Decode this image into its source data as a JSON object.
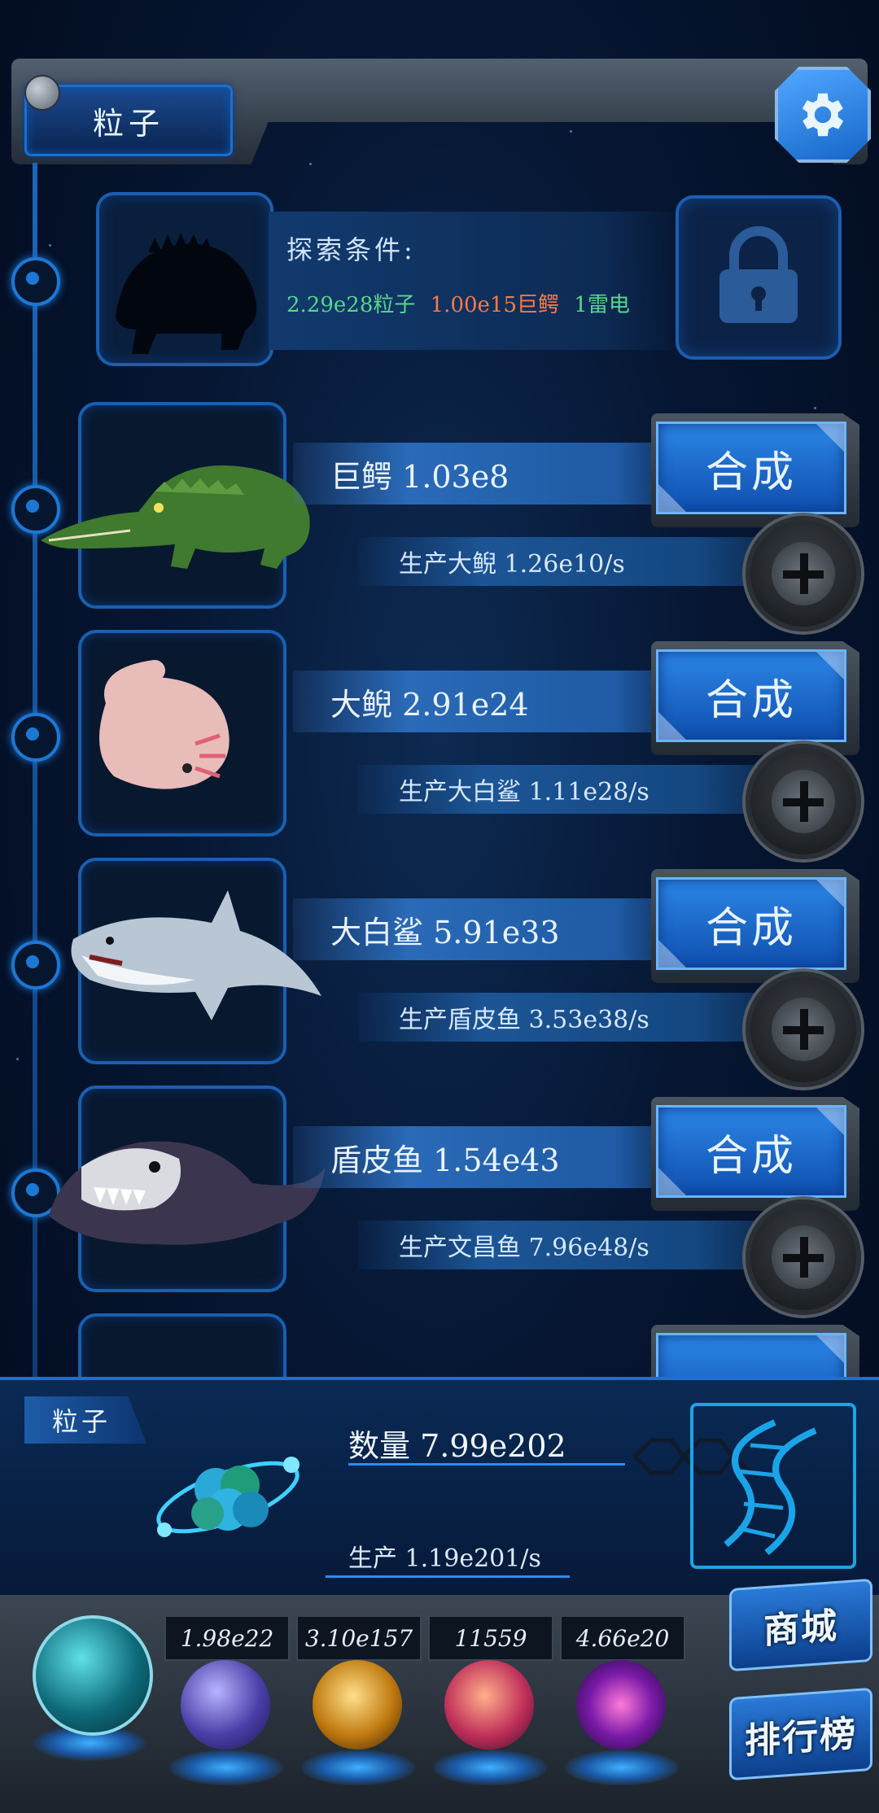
{
  "top_bar": {
    "category_tab": "粒子"
  },
  "locked": {
    "title": "探索条件:",
    "requirements": [
      {
        "text": "2.29e28粒子",
        "color": "#58d68d"
      },
      {
        "text": "1.00e15巨鳄",
        "color": "#ff7a45"
      },
      {
        "text": "1雷电",
        "color": "#58d68d"
      }
    ]
  },
  "creatures": [
    {
      "name": "巨鳄 1.03e8",
      "production": "生产大鲵 1.26e10/s",
      "synth_label": "合成",
      "art": "crocodile"
    },
    {
      "name": "大鲵 2.91e24",
      "production": "生产大白鲨 1.11e28/s",
      "synth_label": "合成",
      "art": "axolotl"
    },
    {
      "name": "大白鲨 5.91e33",
      "production": "生产盾皮鱼 3.53e38/s",
      "synth_label": "合成",
      "art": "shark"
    },
    {
      "name": "盾皮鱼 1.54e43",
      "production": "生产文昌鱼 7.96e48/s",
      "synth_label": "合成",
      "art": "dunkleosteus"
    }
  ],
  "resource": {
    "tab": "粒子",
    "amount": "数量 7.99e202",
    "rate": "生产 1.19e201/s"
  },
  "bottom_bar": {
    "values": [
      "1.98e22",
      "3.10e157",
      "11559",
      "4.66e20"
    ],
    "shop_label": "商城",
    "rank_label": "排行榜",
    "orbs": [
      "particle-orb",
      "lightning-orb",
      "fire-orb",
      "brain-orb",
      "vortex-orb"
    ]
  },
  "colors": {
    "accent": "#1a6fd1",
    "button": "#2c86e6"
  }
}
